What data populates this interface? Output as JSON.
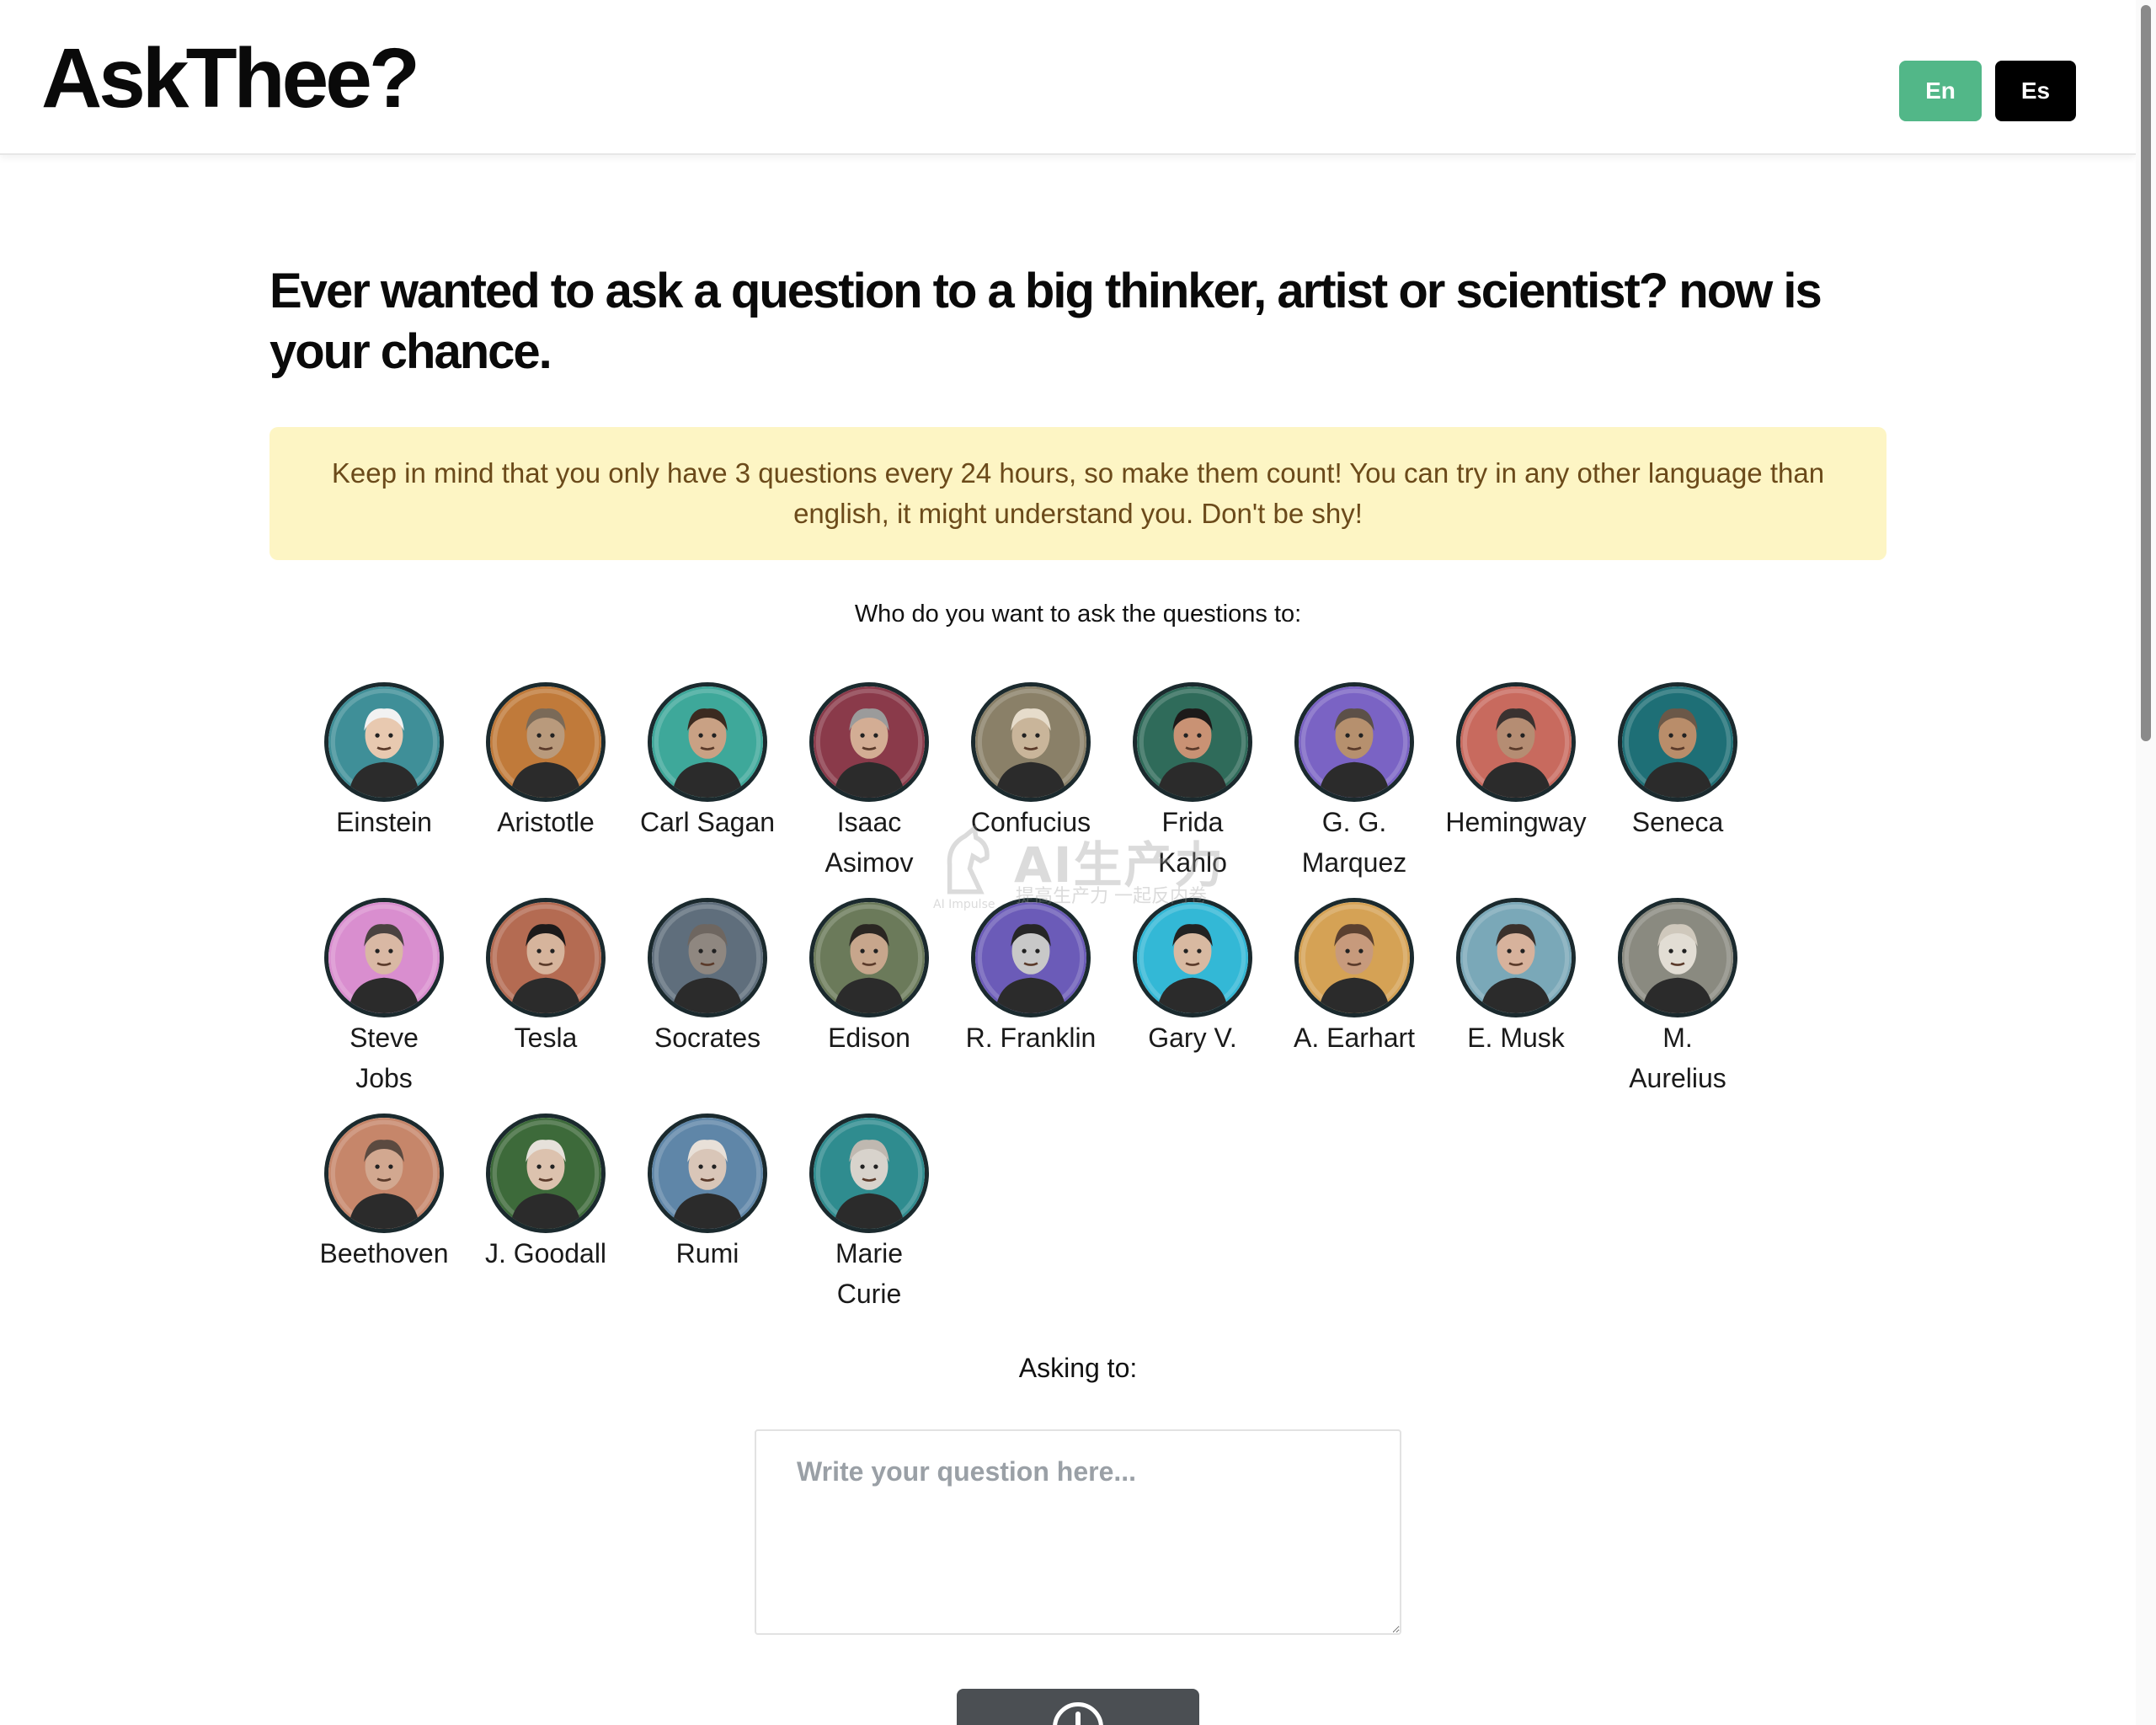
{
  "header": {
    "logo": "AskThee?",
    "lang_en": "En",
    "lang_es": "Es"
  },
  "main": {
    "headline": "Ever wanted to ask a question to a big thinker, artist or scientist? now is your chance.",
    "notice": "Keep in mind that you only have 3 questions every 24 hours, so make them count!  You can try in any other language than english, it might understand you. Don't be shy!",
    "who_label": "Who do you want to ask the questions to:",
    "asking_label": "Asking to:",
    "question_placeholder": "Write your question here..."
  },
  "people": [
    {
      "name": "Einstein",
      "line1": "Einstein",
      "line2": "",
      "bg": "#3f8f98",
      "skin": "#e8c9b0",
      "hair": "#f2f2f2"
    },
    {
      "name": "Aristotle",
      "line1": "Aristotle",
      "line2": "",
      "bg": "#c07a3a",
      "skin": "#b99a7c",
      "hair": "#7a6a58"
    },
    {
      "name": "Carl Sagan",
      "line1": "Carl Sagan",
      "line2": "",
      "bg": "#3ea89a",
      "skin": "#c9a184",
      "hair": "#3b2a20"
    },
    {
      "name": "Isaac Asimov",
      "line1": "Isaac",
      "line2": "Asimov",
      "bg": "#8a3a4a",
      "skin": "#d3ad94",
      "hair": "#9b9b9b"
    },
    {
      "name": "Confucius",
      "line1": "Confucius",
      "line2": "",
      "bg": "#8a8068",
      "skin": "#c9b59a",
      "hair": "#e6dccb"
    },
    {
      "name": "Frida Kahlo",
      "line1": "Frida",
      "line2": "Kahlo",
      "bg": "#2f6b5a",
      "skin": "#c99274",
      "hair": "#1d1a19"
    },
    {
      "name": "G. G. Marquez",
      "line1": "G. G.",
      "line2": "Marquez",
      "bg": "#7a63c4",
      "skin": "#b6906e",
      "hair": "#5c5048"
    },
    {
      "name": "Hemingway",
      "line1": "Hemingway",
      "line2": "",
      "bg": "#c86a5e",
      "skin": "#b58d73",
      "hair": "#3a3230"
    },
    {
      "name": "Seneca",
      "line1": "Seneca",
      "line2": "",
      "bg": "#1e6f76",
      "skin": "#b98d6a",
      "hair": "#6b5848"
    },
    {
      "name": "Steve Jobs",
      "line1": "Steve",
      "line2": "Jobs",
      "bg": "#d98ecf",
      "skin": "#d9b8a4",
      "hair": "#4a4240"
    },
    {
      "name": "Tesla",
      "line1": "Tesla",
      "line2": "",
      "bg": "#b46b52",
      "skin": "#d6b49c",
      "hair": "#1d1a1a"
    },
    {
      "name": "Socrates",
      "line1": "Socrates",
      "line2": "",
      "bg": "#5f6e7c",
      "skin": "#8f8780",
      "hair": "#6e6660"
    },
    {
      "name": "Edison",
      "line1": "Edison",
      "line2": "",
      "bg": "#6b7a5a",
      "skin": "#c7a68c",
      "hair": "#2a2622"
    },
    {
      "name": "R. Franklin",
      "line1": "R. Franklin",
      "line2": "",
      "bg": "#6b5bb8",
      "skin": "#c8c8c8",
      "hair": "#262626"
    },
    {
      "name": "Gary V.",
      "line1": "Gary V.",
      "line2": "",
      "bg": "#33b8d6",
      "skin": "#d8b9a1",
      "hair": "#222222"
    },
    {
      "name": "A. Earhart",
      "line1": "A. Earhart",
      "line2": "",
      "bg": "#d5a255",
      "skin": "#c79a7c",
      "hair": "#5a4030"
    },
    {
      "name": "E. Musk",
      "line1": "E. Musk",
      "line2": "",
      "bg": "#7aa8b8",
      "skin": "#d7b29c",
      "hair": "#3a302b"
    },
    {
      "name": "M. Aurelius",
      "line1": "M.",
      "line2": "Aurelius",
      "bg": "#8a8a80",
      "skin": "#e2ddd4",
      "hair": "#cfc8bc"
    },
    {
      "name": "Beethoven",
      "line1": "Beethoven",
      "line2": "",
      "bg": "#c6866a",
      "skin": "#d2a890",
      "hair": "#5b4a40"
    },
    {
      "name": "J. Goodall",
      "line1": "J. Goodall",
      "line2": "",
      "bg": "#3d6a3a",
      "skin": "#dcc2ae",
      "hair": "#e6e1da"
    },
    {
      "name": "Rumi",
      "line1": "Rumi",
      "line2": "",
      "bg": "#5f86a8",
      "skin": "#d9c6b8",
      "hair": "#e8e0d8"
    },
    {
      "name": "Marie Curie",
      "line1": "Marie",
      "line2": "Curie",
      "bg": "#2f8c8f",
      "skin": "#d8d3cc",
      "hair": "#bfb8b0"
    }
  ],
  "watermark": {
    "main": "AI生产力",
    "sub": "提高生产力 一起反内卷",
    "tiny": "AI Impulse"
  },
  "colors": {
    "accent_green": "#52b788",
    "notice_bg": "#fdf5c4",
    "notice_text": "#6b4a1a"
  }
}
